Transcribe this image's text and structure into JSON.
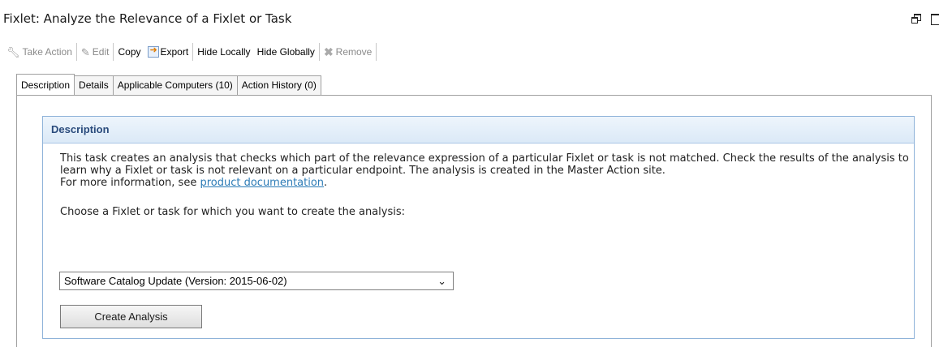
{
  "window": {
    "title": "Fixlet: Analyze the Relevance of a Fixlet or Task"
  },
  "toolbar": {
    "take_action": {
      "label": "Take Action",
      "icon": "wrench-icon",
      "enabled": false
    },
    "edit": {
      "label": "Edit",
      "icon": "pencil-icon",
      "enabled": false
    },
    "copy": {
      "label": "Copy",
      "enabled": true
    },
    "export": {
      "label": "Export",
      "icon": "export-icon",
      "enabled": true
    },
    "hide_locally": {
      "label": "Hide Locally",
      "enabled": true
    },
    "hide_globally": {
      "label": "Hide Globally",
      "enabled": true
    },
    "remove": {
      "label": "Remove",
      "icon": "x-icon",
      "enabled": false
    }
  },
  "tabs": [
    {
      "label": "Description",
      "active": true
    },
    {
      "label": "Details",
      "active": false
    },
    {
      "label": "Applicable Computers (10)",
      "active": false
    },
    {
      "label": "Action History (0)",
      "active": false
    }
  ],
  "description": {
    "header": "Description",
    "paragraph": "This task creates an analysis that checks which part of the relevance expression of a particular Fixlet or task is not matched. Check the results of the analysis to learn why a Fixlet or task is not relevant on a particular endpoint. The analysis is created in the Master Action site.",
    "more_info_prefix": "For more information, see ",
    "more_info_link": "product documentation",
    "more_info_suffix": ".",
    "choose_label": "Choose a Fixlet or task for which you want to create the analysis:",
    "select_value": "Software Catalog Update (Version: 2015-06-02)",
    "create_button": "Create Analysis"
  },
  "colors": {
    "header_text": "#2a4b7c",
    "link": "#2c7bb6",
    "box_border": "#8fb3d9"
  }
}
